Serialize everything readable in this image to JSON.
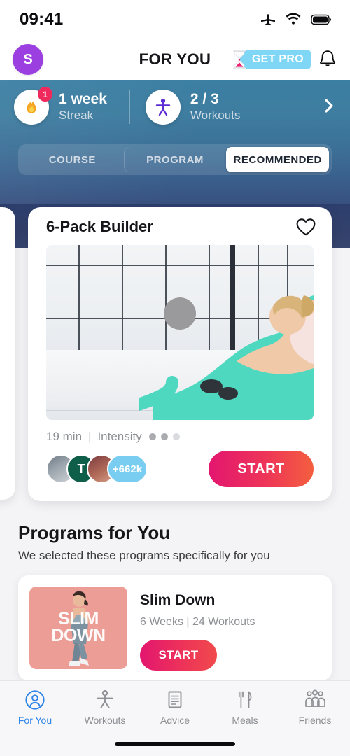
{
  "status_bar": {
    "time": "09:41",
    "icons": [
      "airplane-icon",
      "wifi-icon",
      "battery-icon"
    ]
  },
  "header": {
    "avatar_initial": "S",
    "title": "FOR YOU",
    "pro_label": "GET PRO",
    "icons": [
      "hourglass-icon",
      "bell-icon"
    ]
  },
  "banner": {
    "streak": {
      "value": "1 week",
      "label": "Streak",
      "badge": "1",
      "icon": "flame-icon"
    },
    "workouts": {
      "value": "2 / 3",
      "label": "Workouts",
      "icon": "person-exercise-icon"
    },
    "chevron": "chevron-right-icon"
  },
  "tabs": [
    {
      "label": "COURSE",
      "active": false
    },
    {
      "label": "PROGRAM",
      "active": false
    },
    {
      "label": "RECOMMENDED",
      "active": true
    }
  ],
  "workout_card": {
    "title": "6-Pack Builder",
    "favorite_icon": "heart-outline-icon",
    "duration": "19 min",
    "separator": "|",
    "intensity_label": "Intensity",
    "intensity_filled": 2,
    "intensity_total": 3,
    "avatars": [
      {
        "type": "photo",
        "label": ""
      },
      {
        "type": "initial",
        "label": "T"
      },
      {
        "type": "photo",
        "label": ""
      }
    ],
    "avatar_overflow": "+662k",
    "start_label": "START",
    "play_icon": "play-circle-icon"
  },
  "programs": {
    "title": "Programs for You",
    "subtitle": "We selected these programs specifically for you",
    "items": [
      {
        "name": "Slim Down",
        "meta": "6 Weeks | 24 Workouts",
        "thumb_line1": "SLIM",
        "thumb_line2": "DOWN",
        "start_label": "START"
      }
    ]
  },
  "bottom_nav": [
    {
      "label": "For You",
      "icon": "person-circle-icon",
      "active": true
    },
    {
      "label": "Workouts",
      "icon": "exercise-person-icon",
      "active": false
    },
    {
      "label": "Advice",
      "icon": "document-icon",
      "active": false
    },
    {
      "label": "Meals",
      "icon": "fork-knife-icon",
      "active": false
    },
    {
      "label": "Friends",
      "icon": "people-group-icon",
      "active": false
    }
  ],
  "colors": {
    "accent_blue": "#2f86e8",
    "pro_badge": "#7fd6f5",
    "avatar_purple": "#9b3fe0",
    "badge_red": "#f0295d",
    "start_gradient_from": "#e3166f",
    "start_gradient_to": "#f45f3f",
    "banner_top": "#3b7fa3",
    "banner_bottom": "#38507f",
    "thumb_pink": "#eb9d96"
  }
}
